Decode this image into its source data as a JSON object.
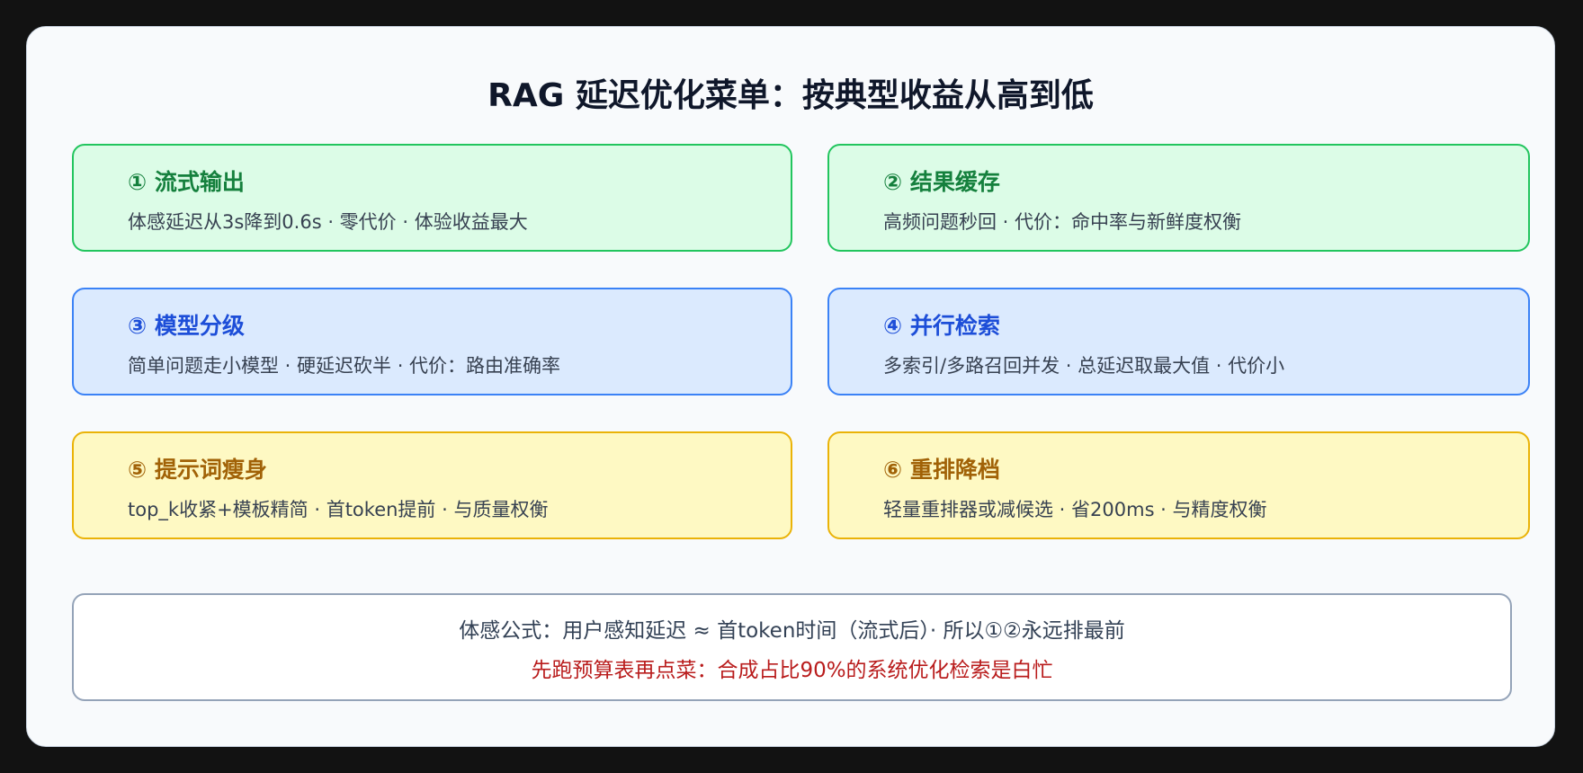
{
  "title": "RAG 延迟优化菜单：按典型收益从高到低",
  "cards": [
    {
      "title": "① 流式输出",
      "desc": "体感延迟从3s降到0.6s · 零代价 · 体验收益最大",
      "color": "#22c55e"
    },
    {
      "title": "② 结果缓存",
      "desc": "高频问题秒回 · 代价：命中率与新鲜度权衡",
      "color": "#22c55e"
    },
    {
      "title": "③ 模型分级",
      "desc": "简单问题走小模型 · 硬延迟砍半 · 代价：路由准确率",
      "color": "#3b82f6"
    },
    {
      "title": "④ 并行检索",
      "desc": "多索引/多路召回并发 · 总延迟取最大值 · 代价小",
      "color": "#3b82f6"
    },
    {
      "title": "⑤ 提示词瘦身",
      "desc": "top_k收紧+模板精简 · 首token提前 · 与质量权衡",
      "color": "#eab308"
    },
    {
      "title": "⑥ 重排降档",
      "desc": "轻量重排器或减候选 · 省200ms · 与精度权衡",
      "color": "#eab308"
    }
  ],
  "formula": {
    "line1": "体感公式：用户感知延迟 ≈ 首token时间（流式后）· 所以①②永远排最前",
    "line2": "先跑预算表再点菜：合成占比90%的系统优化检索是白忙",
    "line2_color": "#b91c1c"
  }
}
